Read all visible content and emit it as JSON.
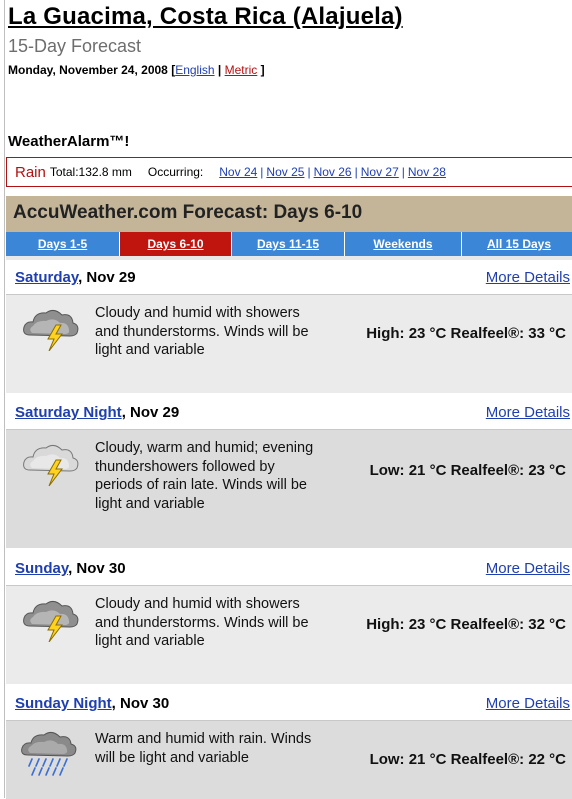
{
  "header": {
    "location": "La Guacima, Costa Rica (Alajuela)",
    "subtitle": "15-Day Forecast",
    "date": "Monday, November 24, 2008",
    "open_bracket": "[",
    "english_link": "English",
    "divider": "|",
    "metric_link": "Metric",
    "close_bracket": "]"
  },
  "alarm": {
    "title": "WeatherAlarm™!",
    "type": "Rain",
    "total": "Total:132.8 mm",
    "occurring": "Occurring:",
    "dates": [
      "Nov 24",
      "Nov 25",
      "Nov 26",
      "Nov 27",
      "Nov 28"
    ],
    "separator": "|"
  },
  "forecast": {
    "header": "AccuWeather.com Forecast: Days 6-10",
    "tabs": [
      "Days 1-5",
      "Days 6-10",
      "Days 11-15",
      "Weekends",
      "All 15 Days"
    ],
    "active_tab": "Days 6-10",
    "days": [
      {
        "day_link": "Saturday",
        "date": ", Nov 29",
        "more": "More Details",
        "description": "Cloudy and humid with showers and thunderstorms. Winds will be light and variable",
        "temperature": "High: 23 °C Realfeel®: 33 °C",
        "icon": "thunderstorm-icon"
      },
      {
        "day_link": "Saturday Night",
        "date": ", Nov 29",
        "more": "More Details",
        "description": "Cloudy, warm and humid; evening thundershowers followed by periods of rain late. Winds will be light and variable",
        "temperature": "Low: 21 °C Realfeel®: 23 °C",
        "icon": "thunderstorm-icon"
      },
      {
        "day_link": "Sunday",
        "date": ", Nov 30",
        "more": "More Details",
        "description": "Cloudy and humid with showers and thunderstorms. Winds will be light and variable",
        "temperature": "High: 23 °C Realfeel®: 32 °C",
        "icon": "thunderstorm-icon"
      },
      {
        "day_link": "Sunday Night",
        "date": ", Nov 30",
        "more": "More Details",
        "description": "Warm and humid with rain. Winds will be light and variable",
        "temperature": "Low: 21 °C Realfeel®: 22 °C",
        "icon": "rain-icon"
      }
    ]
  },
  "colors": {
    "link_blue": "#1f3fb0",
    "alarm_red": "#b31111",
    "tab_blue": "#3b86d6",
    "tab_active_red": "#c0150f",
    "header_tan": "#c4b598"
  }
}
